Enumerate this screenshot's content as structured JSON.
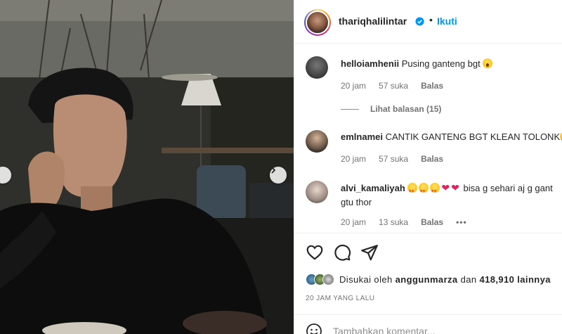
{
  "post": {
    "image_alt": "",
    "nav": {
      "prev_icon": "chevron-left-icon",
      "next_icon": "chevron-right-icon"
    }
  },
  "header": {
    "username": "thariqhalilintar",
    "verified_icon": "verified-badge-icon",
    "separator": "•",
    "follow_label": "Ikuti",
    "follow_color": "#0095f6"
  },
  "comments": [
    {
      "username": "helloiamhenii",
      "text": "Pusing ganteng bgt",
      "emoji": [
        "astonished-face-emoji"
      ],
      "time": "20 jam",
      "likes": "57 suka",
      "reply_label": "Balas",
      "view_replies": "Lihat balasan (15)"
    },
    {
      "username": "emlnamei",
      "text": "CANTIK GANTENG BGT KLEAN TOLONK",
      "emoji": [
        "star-struck-emoji"
      ],
      "time": "20 jam",
      "likes": "57 suka",
      "reply_label": "Balas"
    },
    {
      "username": "alvi_kamaliyah",
      "emoji": [
        "star-struck-emoji",
        "star-struck-emoji",
        "star-struck-emoji",
        "red-heart-emoji",
        "red-heart-emoji"
      ],
      "text": "bisa g sehari aj g gant gtu thor",
      "time": "20 jam",
      "likes": "13 suka",
      "reply_label": "Balas",
      "more": "•••"
    }
  ],
  "actions": {
    "like_icon": "heart-outline-icon",
    "comment_icon": "comment-bubble-icon",
    "share_icon": "paper-plane-icon"
  },
  "likes": {
    "prefix": "Disukai oleh",
    "user": "anggunmarza",
    "conj": "dan",
    "count": "418,910 lainnya"
  },
  "timestamp": "20 JAM YANG LALU",
  "add_comment": {
    "placeholder": "Tambahkan komentar...",
    "icon": "smiley-icon"
  }
}
